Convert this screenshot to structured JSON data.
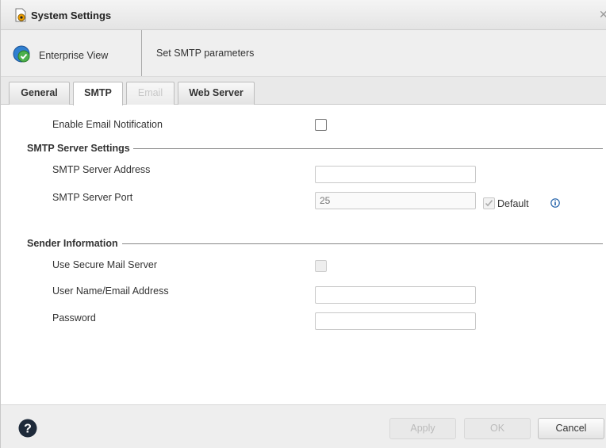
{
  "window": {
    "title": "System Settings",
    "title_icon": "settings-gear-icon",
    "close_icon": "close-icon"
  },
  "breadcrumb": {
    "view_label": "Enterprise View",
    "page_title": "Set SMTP parameters"
  },
  "tabs": [
    {
      "label": "General",
      "active": false,
      "enabled": true
    },
    {
      "label": "SMTP",
      "active": true,
      "enabled": true
    },
    {
      "label": "Email",
      "active": false,
      "enabled": false
    },
    {
      "label": "Web Server",
      "active": false,
      "enabled": true
    }
  ],
  "form": {
    "enable_email_notification": {
      "label": "Enable Email Notification",
      "checked": false
    },
    "smtp_section": {
      "title": "SMTP Server Settings",
      "server_address": {
        "label": "SMTP Server Address",
        "value": ""
      },
      "server_port": {
        "label": "SMTP Server Port",
        "value": "",
        "placeholder": "25",
        "default_label": "Default",
        "default_checked": true
      }
    },
    "sender_section": {
      "title": "Sender Information",
      "use_secure": {
        "label": "Use Secure Mail Server",
        "checked": false
      },
      "username": {
        "label": "User Name/Email Address",
        "value": ""
      },
      "password": {
        "label": "Password",
        "value": ""
      }
    }
  },
  "footer": {
    "apply_label": "Apply",
    "ok_label": "OK",
    "cancel_label": "Cancel",
    "help_icon": "help-icon"
  },
  "colors": {
    "accent_blue": "#1f5fa8",
    "check_green": "#3a9a3a",
    "disabled_text": "#bbbbbb"
  }
}
